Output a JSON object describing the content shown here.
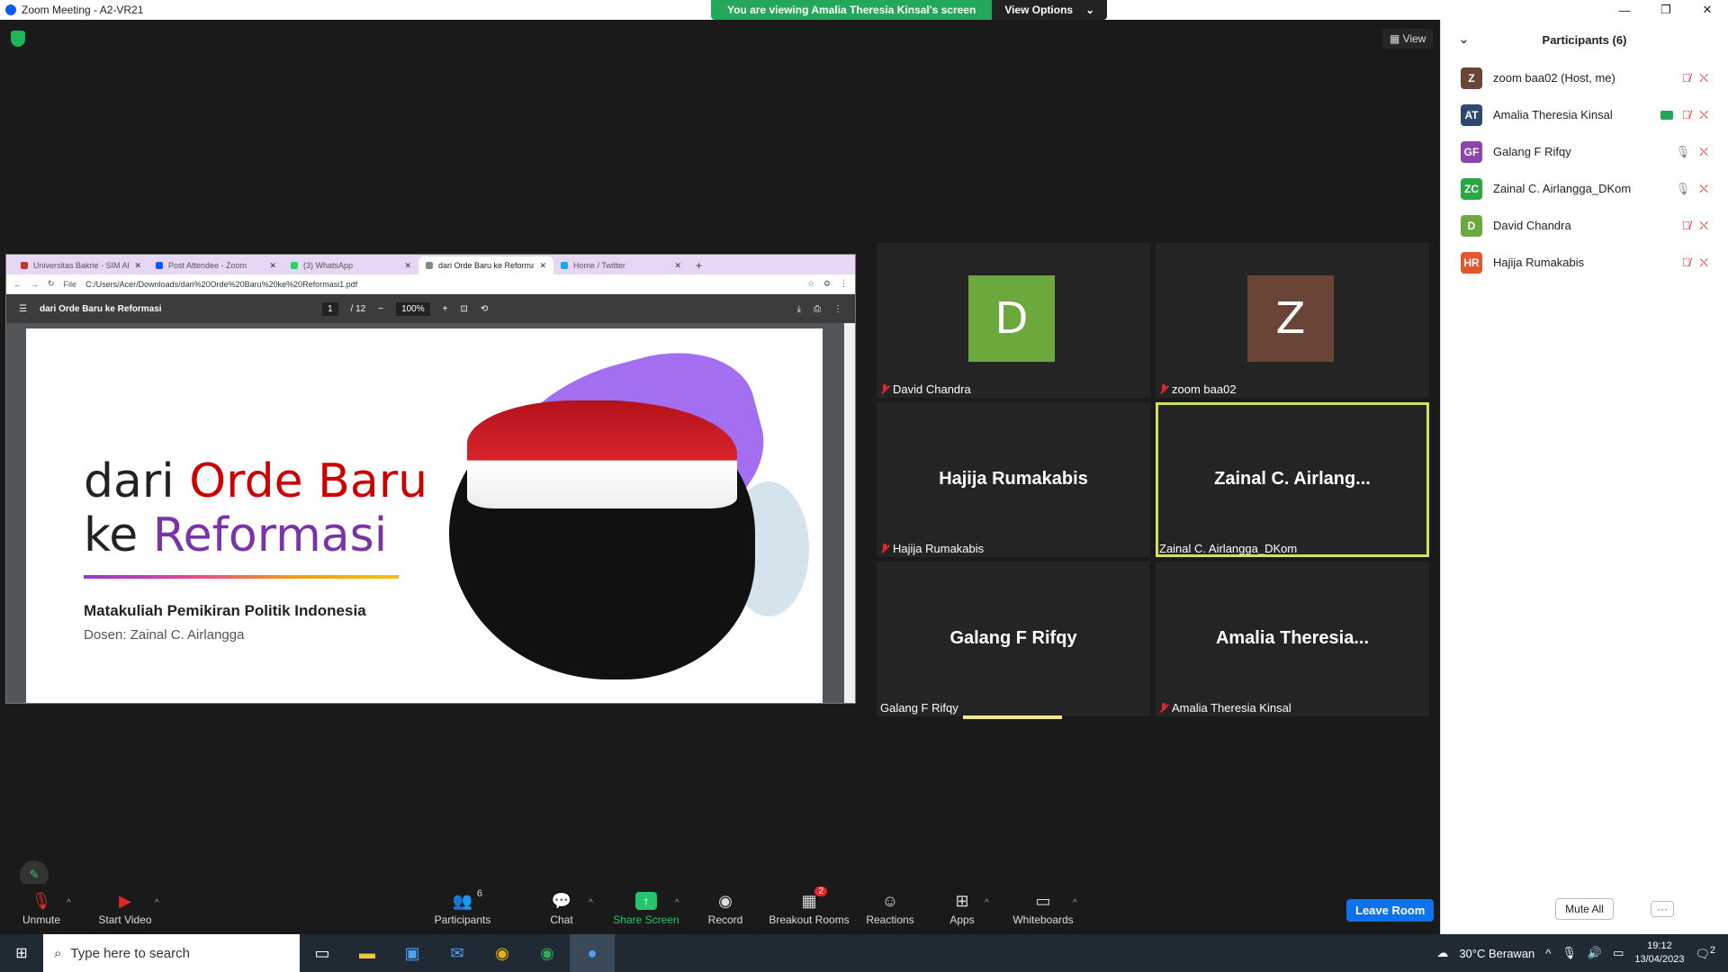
{
  "window": {
    "title": "Zoom Meeting - A2-VR21",
    "controls": [
      "—",
      "❐",
      "✕"
    ]
  },
  "share_banner": {
    "message": "You are viewing Amalia Theresia Kinsal's screen",
    "view_options": "View Options"
  },
  "view_button": "View",
  "browser": {
    "tabs": [
      {
        "label": "Universitas Bakrie - SIM Akad",
        "color": "#c0392b"
      },
      {
        "label": "Post Attendee - Zoom",
        "color": "#0b5cff"
      },
      {
        "label": "(3) WhatsApp",
        "color": "#25d366"
      },
      {
        "label": "dari Orde Baru ke Reformasi",
        "color": "#888"
      },
      {
        "label": "Home / Twitter",
        "color": "#1da1f2"
      }
    ],
    "url_prefix": "File",
    "url": "C:/Users/Acer/Downloads/dari%20Orde%20Baru%20ke%20Reformasi1.pdf",
    "pdf_title": "dari Orde Baru ke Reformasi",
    "page_current": "1",
    "page_total": "/ 12",
    "zoom": "100%"
  },
  "slide": {
    "title_part1": "dari ",
    "title_red": "Orde Baru",
    "title_part2": "ke ",
    "title_purple": "Reformasi",
    "subtitle": "Matakuliah Pemikiran Politik Indonesia",
    "lecturer": "Dosen: Zainal C. Airlangga"
  },
  "tiles": [
    {
      "name": "David Chandra",
      "avatar": "D",
      "avatar_color": "#6ca83b",
      "muted": true
    },
    {
      "name": "zoom baa02",
      "avatar": "Z",
      "avatar_color": "#6b4438",
      "muted": true
    },
    {
      "name": "Hajija Rumakabis",
      "big": "Hajija Rumakabis",
      "muted": true
    },
    {
      "name": "Zainal C. Airlangga_DKom",
      "big": "Zainal  C. Airlang...",
      "muted": false
    },
    {
      "name": "Galang F Rifqy",
      "big": "Galang F Rifqy",
      "muted": false
    },
    {
      "name": "Amalia Theresia Kinsal",
      "big": "Amalia  Theresia...",
      "muted": true
    }
  ],
  "toolbar": {
    "unmute": "Unmute",
    "start_video": "Start Video",
    "participants": "Participants",
    "participants_count": "6",
    "chat": "Chat",
    "share_screen": "Share Screen",
    "record": "Record",
    "breakout": "Breakout Rooms",
    "breakout_badge": "2",
    "reactions": "Reactions",
    "apps": "Apps",
    "whiteboards": "Whiteboards",
    "leave": "Leave Room"
  },
  "panel": {
    "title": "Participants (6)",
    "participants": [
      {
        "initials": "Z",
        "name": "zoom baa02 (Host, me)",
        "color": "#6b4438"
      },
      {
        "initials": "AT",
        "name": "Amalia Theresia Kinsal",
        "color": "#2d4a6e"
      },
      {
        "initials": "GF",
        "name": "Galang F Rifqy",
        "color": "#8e44ad"
      },
      {
        "initials": "ZC",
        "name": "Zainal C. Airlangga_DKom",
        "color": "#27a844"
      },
      {
        "initials": "D",
        "name": "David Chandra",
        "color": "#6ca83b"
      },
      {
        "initials": "HR",
        "name": "Hajija Rumakabis",
        "color": "#e4572e"
      }
    ],
    "mute_all": "Mute All",
    "more": "···"
  },
  "taskbar": {
    "search_placeholder": "Type here to search",
    "weather": "30°C  Berawan",
    "time": "19:12",
    "date": "13/04/2023",
    "notifications": "2"
  }
}
